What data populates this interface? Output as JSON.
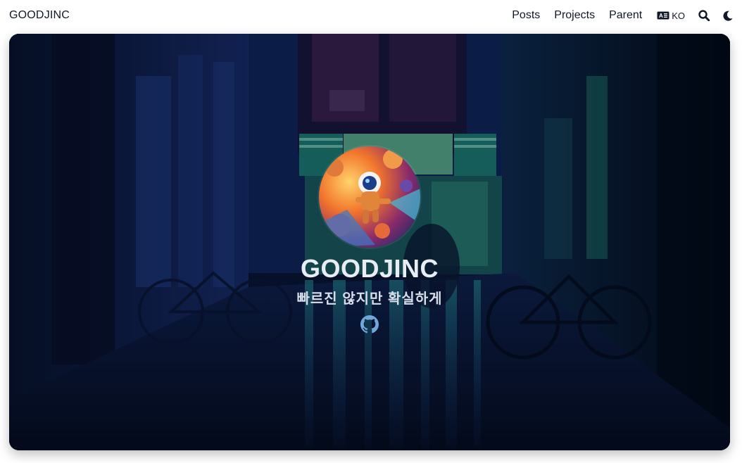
{
  "nav": {
    "brand": "GOODJINC",
    "links": [
      "Posts",
      "Projects",
      "Parent"
    ],
    "lang_label": "KO",
    "icons": [
      "language-icon",
      "search-icon",
      "moon-icon"
    ]
  },
  "hero": {
    "title": "GOODJINC",
    "subtitle": "빠르진 않지만 확실하게",
    "social_icon": "github-icon",
    "background": "night alley with neon signs and bicycles",
    "avatar": "astronaut illustration"
  },
  "colors": {
    "accent_link": "#6fa8dc",
    "hero_bg": "#06122a",
    "teal_neon": "#1f9c86"
  }
}
